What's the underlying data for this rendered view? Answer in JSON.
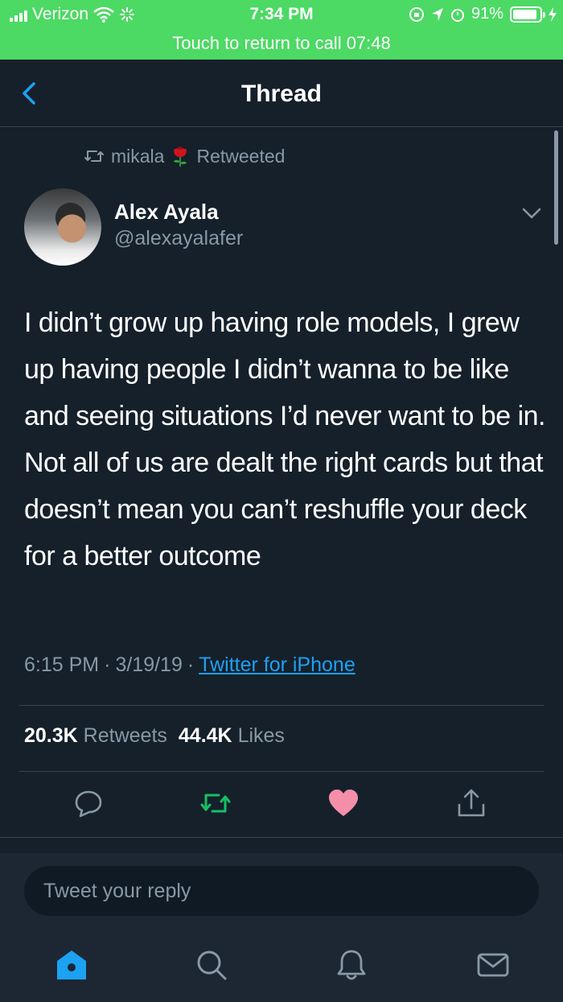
{
  "status_bar": {
    "carrier": "Verizon",
    "time": "7:34 PM",
    "battery": "91%",
    "battery_level": 0.91,
    "call_banner": "Touch to return to call 07:48"
  },
  "nav": {
    "title": "Thread"
  },
  "retweet": {
    "user": "mikala",
    "label": "Retweeted"
  },
  "tweet": {
    "author_name": "Alex Ayala",
    "author_handle": "@alexayalafer",
    "text": "I didn’t grow up having role models, I grew up having people I didn’t wanna to be like and seeing situations I’d never want to be in. Not all of us are dealt the right cards but that doesn’t mean you can’t reshuffle your deck for a better outcome",
    "time": "6:15 PM",
    "date": "3/19/19",
    "source": "Twitter for iPhone",
    "retweet_count": "20.3K",
    "retweets_label": "Retweets",
    "like_count": "44.4K",
    "likes_label": "Likes"
  },
  "reply": {
    "placeholder": "Tweet your reply"
  },
  "colors": {
    "background": "#15202b",
    "status_bar": "#4cd964",
    "secondary_text": "#8899a6",
    "link": "#1da1f2",
    "retweet_green": "#17bf63",
    "like_pink": "#e0245e",
    "home_active": "#1da1f2"
  },
  "icons": {
    "tabs": [
      "home-icon",
      "search-icon",
      "notifications-icon",
      "messages-icon"
    ],
    "actions": [
      "reply-icon",
      "retweet-icon",
      "like-icon",
      "share-icon"
    ]
  }
}
